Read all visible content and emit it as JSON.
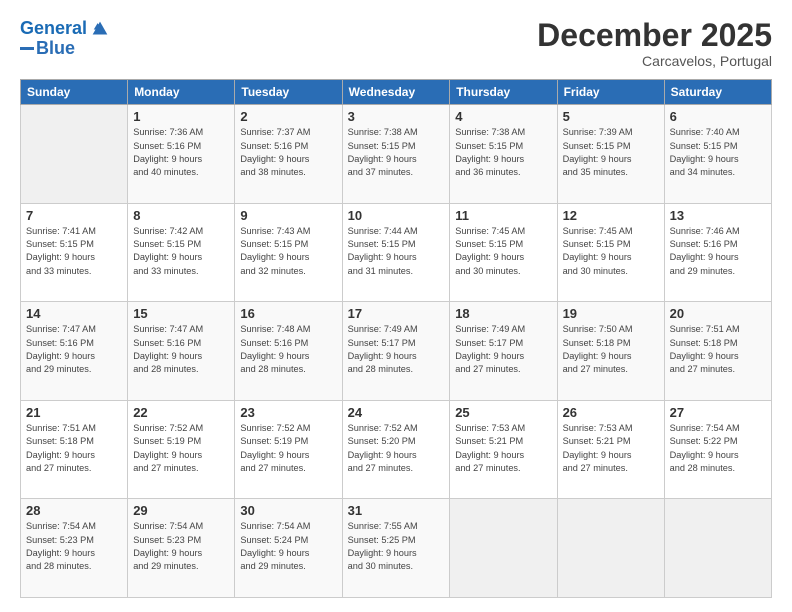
{
  "header": {
    "logo_line1": "General",
    "logo_line2": "Blue",
    "month": "December 2025",
    "location": "Carcavelos, Portugal"
  },
  "weekdays": [
    "Sunday",
    "Monday",
    "Tuesday",
    "Wednesday",
    "Thursday",
    "Friday",
    "Saturday"
  ],
  "weeks": [
    [
      {
        "day": "",
        "info": ""
      },
      {
        "day": "1",
        "info": "Sunrise: 7:36 AM\nSunset: 5:16 PM\nDaylight: 9 hours\nand 40 minutes."
      },
      {
        "day": "2",
        "info": "Sunrise: 7:37 AM\nSunset: 5:16 PM\nDaylight: 9 hours\nand 38 minutes."
      },
      {
        "day": "3",
        "info": "Sunrise: 7:38 AM\nSunset: 5:15 PM\nDaylight: 9 hours\nand 37 minutes."
      },
      {
        "day": "4",
        "info": "Sunrise: 7:38 AM\nSunset: 5:15 PM\nDaylight: 9 hours\nand 36 minutes."
      },
      {
        "day": "5",
        "info": "Sunrise: 7:39 AM\nSunset: 5:15 PM\nDaylight: 9 hours\nand 35 minutes."
      },
      {
        "day": "6",
        "info": "Sunrise: 7:40 AM\nSunset: 5:15 PM\nDaylight: 9 hours\nand 34 minutes."
      }
    ],
    [
      {
        "day": "7",
        "info": "Sunrise: 7:41 AM\nSunset: 5:15 PM\nDaylight: 9 hours\nand 33 minutes."
      },
      {
        "day": "8",
        "info": "Sunrise: 7:42 AM\nSunset: 5:15 PM\nDaylight: 9 hours\nand 33 minutes."
      },
      {
        "day": "9",
        "info": "Sunrise: 7:43 AM\nSunset: 5:15 PM\nDaylight: 9 hours\nand 32 minutes."
      },
      {
        "day": "10",
        "info": "Sunrise: 7:44 AM\nSunset: 5:15 PM\nDaylight: 9 hours\nand 31 minutes."
      },
      {
        "day": "11",
        "info": "Sunrise: 7:45 AM\nSunset: 5:15 PM\nDaylight: 9 hours\nand 30 minutes."
      },
      {
        "day": "12",
        "info": "Sunrise: 7:45 AM\nSunset: 5:15 PM\nDaylight: 9 hours\nand 30 minutes."
      },
      {
        "day": "13",
        "info": "Sunrise: 7:46 AM\nSunset: 5:16 PM\nDaylight: 9 hours\nand 29 minutes."
      }
    ],
    [
      {
        "day": "14",
        "info": "Sunrise: 7:47 AM\nSunset: 5:16 PM\nDaylight: 9 hours\nand 29 minutes."
      },
      {
        "day": "15",
        "info": "Sunrise: 7:47 AM\nSunset: 5:16 PM\nDaylight: 9 hours\nand 28 minutes."
      },
      {
        "day": "16",
        "info": "Sunrise: 7:48 AM\nSunset: 5:16 PM\nDaylight: 9 hours\nand 28 minutes."
      },
      {
        "day": "17",
        "info": "Sunrise: 7:49 AM\nSunset: 5:17 PM\nDaylight: 9 hours\nand 28 minutes."
      },
      {
        "day": "18",
        "info": "Sunrise: 7:49 AM\nSunset: 5:17 PM\nDaylight: 9 hours\nand 27 minutes."
      },
      {
        "day": "19",
        "info": "Sunrise: 7:50 AM\nSunset: 5:18 PM\nDaylight: 9 hours\nand 27 minutes."
      },
      {
        "day": "20",
        "info": "Sunrise: 7:51 AM\nSunset: 5:18 PM\nDaylight: 9 hours\nand 27 minutes."
      }
    ],
    [
      {
        "day": "21",
        "info": "Sunrise: 7:51 AM\nSunset: 5:18 PM\nDaylight: 9 hours\nand 27 minutes."
      },
      {
        "day": "22",
        "info": "Sunrise: 7:52 AM\nSunset: 5:19 PM\nDaylight: 9 hours\nand 27 minutes."
      },
      {
        "day": "23",
        "info": "Sunrise: 7:52 AM\nSunset: 5:19 PM\nDaylight: 9 hours\nand 27 minutes."
      },
      {
        "day": "24",
        "info": "Sunrise: 7:52 AM\nSunset: 5:20 PM\nDaylight: 9 hours\nand 27 minutes."
      },
      {
        "day": "25",
        "info": "Sunrise: 7:53 AM\nSunset: 5:21 PM\nDaylight: 9 hours\nand 27 minutes."
      },
      {
        "day": "26",
        "info": "Sunrise: 7:53 AM\nSunset: 5:21 PM\nDaylight: 9 hours\nand 27 minutes."
      },
      {
        "day": "27",
        "info": "Sunrise: 7:54 AM\nSunset: 5:22 PM\nDaylight: 9 hours\nand 28 minutes."
      }
    ],
    [
      {
        "day": "28",
        "info": "Sunrise: 7:54 AM\nSunset: 5:23 PM\nDaylight: 9 hours\nand 28 minutes."
      },
      {
        "day": "29",
        "info": "Sunrise: 7:54 AM\nSunset: 5:23 PM\nDaylight: 9 hours\nand 29 minutes."
      },
      {
        "day": "30",
        "info": "Sunrise: 7:54 AM\nSunset: 5:24 PM\nDaylight: 9 hours\nand 29 minutes."
      },
      {
        "day": "31",
        "info": "Sunrise: 7:55 AM\nSunset: 5:25 PM\nDaylight: 9 hours\nand 30 minutes."
      },
      {
        "day": "",
        "info": ""
      },
      {
        "day": "",
        "info": ""
      },
      {
        "day": "",
        "info": ""
      }
    ]
  ]
}
